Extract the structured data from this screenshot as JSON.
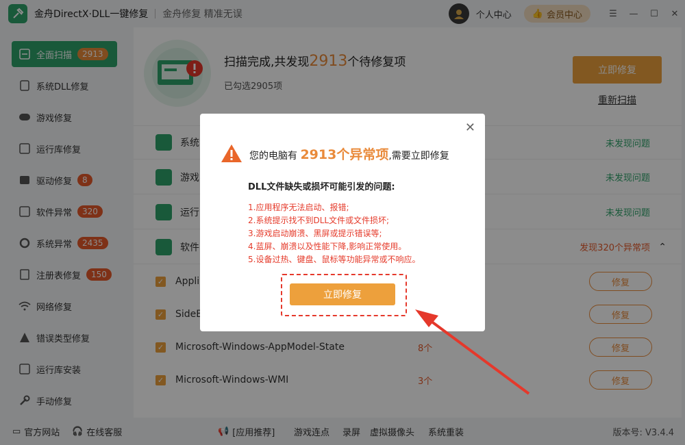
{
  "app": {
    "title": "金舟DirectX·DLL一键修复",
    "slogan": "金舟修复 精准无误",
    "personal_center": "个人中心",
    "vip_center": "会员中心"
  },
  "sidebar": {
    "items": [
      {
        "label": "全面扫描",
        "badge": "2913",
        "icon": "scan-icon",
        "active": true
      },
      {
        "label": "系统DLL修复",
        "badge": "",
        "icon": "dll-icon"
      },
      {
        "label": "游戏修复",
        "badge": "",
        "icon": "gamepad-icon"
      },
      {
        "label": "运行库修复",
        "badge": "",
        "icon": "runtime-icon"
      },
      {
        "label": "驱动修复",
        "badge": "8",
        "icon": "driver-icon"
      },
      {
        "label": "软件异常",
        "badge": "320",
        "icon": "code-icon"
      },
      {
        "label": "系统异常",
        "badge": "2435",
        "icon": "gear-icon"
      },
      {
        "label": "注册表修复",
        "badge": "150",
        "icon": "registry-icon"
      },
      {
        "label": "网络修复",
        "badge": "",
        "icon": "wifi-icon"
      },
      {
        "label": "错误类型修复",
        "badge": "",
        "icon": "warning-icon"
      },
      {
        "label": "运行库安装",
        "badge": "",
        "icon": "install-icon"
      },
      {
        "label": "手动修复",
        "badge": "",
        "icon": "wrench-icon"
      }
    ]
  },
  "scan": {
    "title_prefix": "扫描完成,共发现",
    "count": "2913",
    "title_suffix": "个待修复项",
    "selected": "已勾选2905项",
    "fix_now": "立即修复",
    "rescan": "重新扫描"
  },
  "categories": [
    {
      "name": "系统",
      "status": "未发现问题"
    },
    {
      "name": "游戏",
      "status": "未发现问题"
    },
    {
      "name": "运行",
      "status": "未发现问题"
    },
    {
      "name": "软件",
      "status": "发现320个异常项"
    }
  ],
  "items": [
    {
      "name": "Appli",
      "count": "",
      "fix": "修复"
    },
    {
      "name": "SideB",
      "count": "",
      "fix": "修复"
    },
    {
      "name": "Microsoft-Windows-AppModel-State",
      "count": "8个",
      "fix": "修复"
    },
    {
      "name": "Microsoft-Windows-WMI",
      "count": "3个",
      "fix": "修复"
    }
  ],
  "bottom": {
    "official_site": "官方网站",
    "online_service": "在线客服",
    "recommend": "[应用推荐]",
    "links": [
      "游戏连点",
      "录屏",
      "虚拟摄像头",
      "系统重装"
    ],
    "version": "版本号: V3.4.4"
  },
  "dialog": {
    "head_prefix": "您的电脑有",
    "head_count": "2913个异常项",
    "head_suffix": ",需要立即修复",
    "subtitle": "DLL文件缺失或损坏可能引发的问题:",
    "problems": [
      "1.应用程序无法启动、报错;",
      "2.系统提示找不到DLL文件或文件损坏;",
      "3.游戏启动崩溃、黑屏或提示错误等;",
      "4.蓝屏、崩溃以及性能下降,影响正常使用。",
      "5.设备过热、键盘、鼠标等功能异常或不响应。"
    ],
    "fix_button": "立即修复"
  },
  "colors": {
    "brand_green": "#2fa36b",
    "accent_orange": "#eda03c",
    "alert_red": "#e5382b"
  }
}
